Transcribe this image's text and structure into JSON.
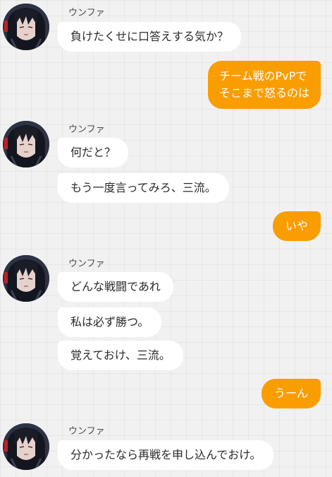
{
  "chat": {
    "sender_name": "ウンファ",
    "messages": [
      {
        "side": "left",
        "text": "負けたくせに口答えする気か？"
      },
      {
        "side": "right",
        "lines": [
          "チーム戦のPvPで",
          "そこまで怒るのは"
        ]
      },
      {
        "side": "left",
        "text": "何だと？"
      },
      {
        "side": "left",
        "text": "もう一度言ってみろ、三流。"
      },
      {
        "side": "right",
        "text": "いや"
      },
      {
        "side": "left",
        "text": "どんな戦闘であれ"
      },
      {
        "side": "left",
        "text": "私は必ず勝つ。"
      },
      {
        "side": "left",
        "text": "覚えておけ、三流。"
      },
      {
        "side": "right",
        "text": "うーん"
      },
      {
        "side": "left",
        "text": "分かったなら再戦を申し込んでおけ。"
      }
    ]
  },
  "colors": {
    "outgoing_bubble": "#fa9d00",
    "incoming_bubble": "#ffffff",
    "background": "#f1f1f2"
  },
  "icons": {
    "avatar": "character-portrait-avatar"
  }
}
